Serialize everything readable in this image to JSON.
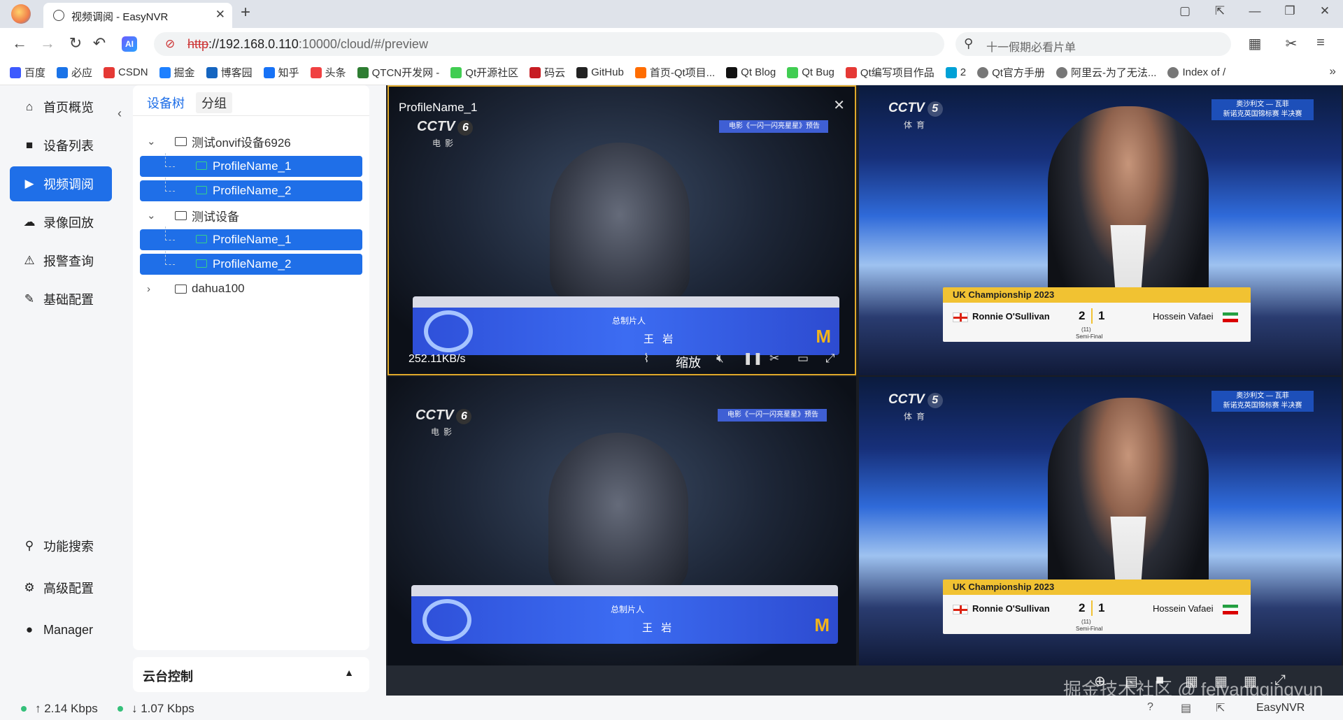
{
  "browser": {
    "tab_title": "视频调阅 - EasyNVR",
    "tab_close": "✕",
    "new_tab": "+",
    "url_scheme": "http",
    "url_host": "://192.168.0.110",
    "url_rest": ":10000/cloud/#/preview",
    "search_placeholder": "十一假期必看片单",
    "bookmarks": [
      {
        "label": "百度",
        "color": "#3d5afe"
      },
      {
        "label": "必应",
        "color": "#1a73e8"
      },
      {
        "label": "CSDN",
        "color": "#e53935"
      },
      {
        "label": "掘金",
        "color": "#1e80ff"
      },
      {
        "label": "博客园",
        "color": "#1565c0"
      },
      {
        "label": "知乎",
        "color": "#1772f6"
      },
      {
        "label": "头条",
        "color": "#f04142"
      },
      {
        "label": "QTCN开发网 -",
        "color": "#2e7d32"
      },
      {
        "label": "Qt开源社区",
        "color": "#41cd52"
      },
      {
        "label": "码云",
        "color": "#c71d23"
      },
      {
        "label": "GitHub",
        "color": "#222222"
      },
      {
        "label": "首页-Qt项目...",
        "color": "#ff6d00"
      },
      {
        "label": "Qt Blog",
        "color": "#111111"
      },
      {
        "label": "Qt Bug",
        "color": "#41cd52"
      },
      {
        "label": "Qt编写项目作品",
        "color": "#e53935"
      },
      {
        "label": "2",
        "color": "#00a1d6"
      },
      {
        "label": "Qt官方手册",
        "color": "#555555"
      },
      {
        "label": "阿里云-为了无法...",
        "color": "#555555"
      },
      {
        "label": "Index of /",
        "color": "#555555"
      }
    ],
    "bookmarks_more": "»"
  },
  "sidebar": {
    "collapse": "‹",
    "items": [
      {
        "label": "首页概览",
        "icon": "home-icon",
        "glyph": "⌂"
      },
      {
        "label": "设备列表",
        "icon": "camera-icon",
        "glyph": "■"
      },
      {
        "label": "视频调阅",
        "icon": "play-icon",
        "glyph": "▶"
      },
      {
        "label": "录像回放",
        "icon": "cloud-icon",
        "glyph": "☁"
      },
      {
        "label": "报警查询",
        "icon": "alarm-icon",
        "glyph": "⚠"
      },
      {
        "label": "基础配置",
        "icon": "edit-icon",
        "glyph": "✎"
      }
    ],
    "bottom_items": [
      {
        "label": "功能搜索",
        "icon": "search-icon",
        "glyph": "⚲"
      },
      {
        "label": "高级配置",
        "icon": "gear-icon",
        "glyph": "⚙"
      },
      {
        "label": "Manager",
        "icon": "user-icon",
        "glyph": "●"
      }
    ]
  },
  "tree": {
    "tabs": [
      "设备树",
      "分组"
    ],
    "nodes": [
      {
        "label": "测试onvif设备6926",
        "expanded": true,
        "children": [
          "ProfileName_1",
          "ProfileName_2"
        ]
      },
      {
        "label": "测试设备",
        "expanded": true,
        "children": [
          "ProfileName_1",
          "ProfileName_2"
        ]
      },
      {
        "label": "dahua100",
        "expanded": false,
        "children": []
      }
    ]
  },
  "ptz": {
    "title": "云台控制",
    "arrow": "▲"
  },
  "video": {
    "cell1_title": "ProfileName_1",
    "cell1_close": "✕",
    "bitrate": "252.11KB/s",
    "zoom_label": "缩放",
    "cctv6_logo": "CCTV",
    "cctv6_num": "6",
    "cctv6_sub": "电影",
    "promo": "电影《一闪一闪亮星星》预告",
    "lower_role": "总制片人",
    "lower_name": "王 岩",
    "lower_logo": "M",
    "cctv5_logo": "CCTV",
    "cctv5_num": "5",
    "cctv5_sub": "体育",
    "corner_line1": "奥沙利文 — 瓦菲",
    "corner_line2": "新诺克英国锦标赛 半决赛",
    "score_title": "UK Championship 2023",
    "player1": "Ronnie O'Sullivan",
    "score1": "2",
    "score2": "1",
    "frames": "(11)",
    "stage": "Semi-Final",
    "player2": "Hossein Vafaei"
  },
  "status": {
    "upload": "↑ 2.14 Kbps",
    "download": "↓ 1.07 Kbps",
    "brand": "EasyNVR",
    "watermark": "掘金技术社区 @ feiyangqingyun",
    "accent": "#1f6fe8",
    "ok": "#35c07a"
  }
}
